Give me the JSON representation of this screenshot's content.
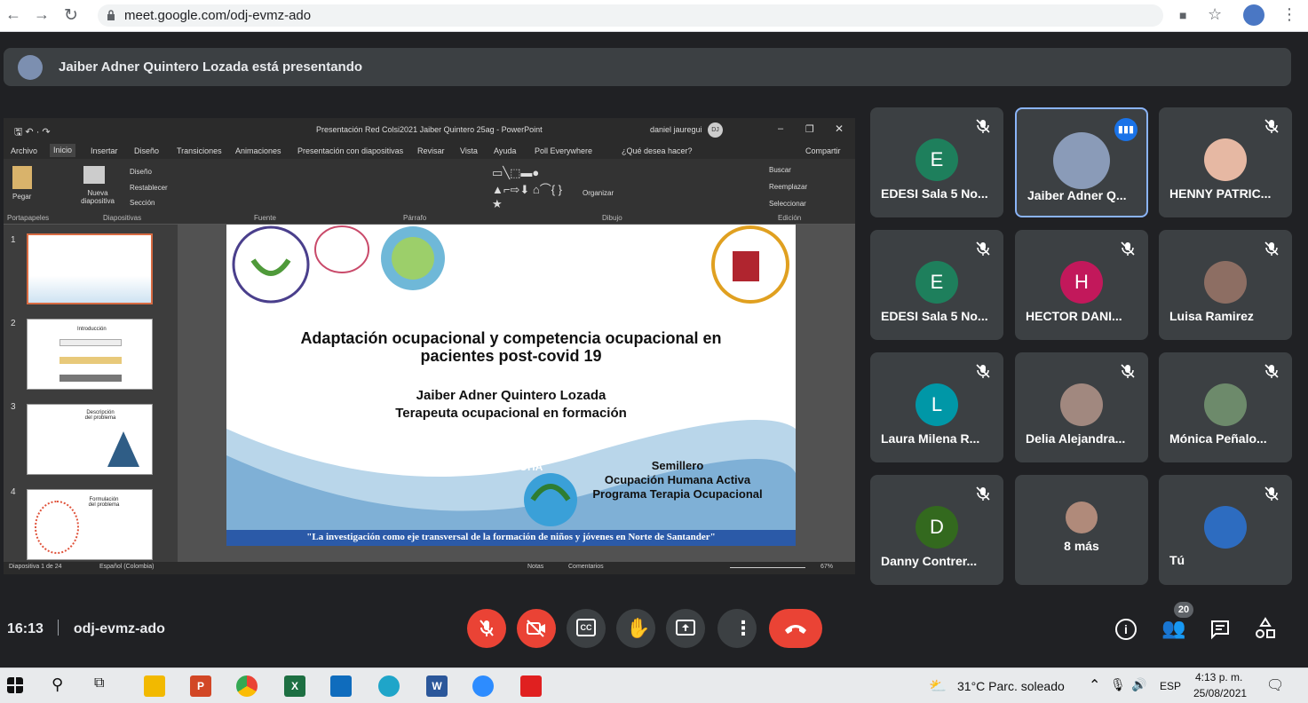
{
  "browser": {
    "url": "meet.google.com/odj-evmz-ado"
  },
  "presenting": {
    "text": "Jaiber Adner Quintero Lozada está presentando"
  },
  "powerpoint": {
    "window_title": "Presentación Red Colsi2021 Jaiber Quintero 25ag  -  PowerPoint",
    "user": "daniel jauregui",
    "user_initials": "DJ",
    "tabs": [
      "Archivo",
      "Inicio",
      "Insertar",
      "Diseño",
      "Transiciones",
      "Animaciones",
      "Presentación con diapositivas",
      "Revisar",
      "Vista",
      "Ayuda",
      "Poll Everywhere",
      "¿Qué desea hacer?",
      "Compartir"
    ],
    "ribbon_groups": [
      "Portapapeles",
      "Diapositivas",
      "Fuente",
      "Párrafo",
      "Dibujo",
      "Edición"
    ],
    "ribbon_cmds": {
      "paste": "Pegar",
      "new_slide": "Nueva diapositiva",
      "layout": "Diseño",
      "reset": "Restablecer",
      "section": "Sección",
      "arrange": "Organizar",
      "find": "Buscar",
      "replace": "Reemplazar",
      "select": "Seleccionar"
    },
    "thumb_labels": [
      "1",
      "2",
      "3",
      "4"
    ],
    "thumb_titles": [
      "",
      "Introducción",
      "Descripción del problema",
      "Formulación del problema"
    ],
    "status": {
      "slide": "Diapositiva 1 de 24",
      "lang": "Español (Colombia)",
      "notes": "Notas",
      "comments": "Comentarios",
      "zoom": "67%"
    },
    "slide": {
      "title_line1": "Adaptación ocupacional y competencia ocupacional en",
      "title_line2": "pacientes post-covid 19",
      "author": "Jaiber Adner Quintero Lozada",
      "role": "Terapeuta ocupacional en formación",
      "group_line1": "Semillero",
      "group_line2": "Ocupación Humana Activa",
      "group_line3": "Programa Terapia Ocupacional",
      "logo_text": "Semillero OHA",
      "footer": "\"La investigación como eje transversal de la formación de niños y jóvenes en Norte de Santander\""
    }
  },
  "participants": [
    {
      "name": "EDESI Sala 5 No...",
      "initial": "E",
      "color": "#1e7f5c",
      "muted": true,
      "photo": false
    },
    {
      "name": "Jaiber Adner Q...",
      "initial": "",
      "color": "#8a9bb8",
      "muted": false,
      "photo": true,
      "speaking": true
    },
    {
      "name": "HENNY PATRIC...",
      "initial": "",
      "color": "#e6b8a3",
      "muted": true,
      "photo": true
    },
    {
      "name": "EDESI Sala 5 No...",
      "initial": "E",
      "color": "#1e7f5c",
      "muted": true,
      "photo": false
    },
    {
      "name": "HECTOR DANI...",
      "initial": "H",
      "color": "#c2185b",
      "muted": true,
      "photo": false
    },
    {
      "name": "Luisa Ramirez",
      "initial": "",
      "color": "#8d6e63",
      "muted": true,
      "photo": true
    },
    {
      "name": "Laura Milena R...",
      "initial": "L",
      "color": "#0097a7",
      "muted": true,
      "photo": false
    },
    {
      "name": "Delia Alejandra...",
      "initial": "",
      "color": "#a1887f",
      "muted": true,
      "photo": true
    },
    {
      "name": "Mónica Peñalo...",
      "initial": "",
      "color": "#6d8a6b",
      "muted": true,
      "photo": true
    },
    {
      "name": "Danny Contrer...",
      "initial": "D",
      "color": "#33691e",
      "muted": true,
      "photo": false
    },
    {
      "name": "8 más",
      "initial": "",
      "color": "#b08a7a",
      "muted": false,
      "photo": true
    },
    {
      "name": "Tú",
      "initial": "",
      "color": "#2d6cc0",
      "muted": true,
      "photo": true
    }
  ],
  "bottom": {
    "time": "16:13",
    "code": "odj-evmz-ado",
    "people_count": "20"
  },
  "taskbar": {
    "weather": "31°C  Parc. soleado",
    "lang": "ESP",
    "time": "4:13 p. m.",
    "date": "25/08/2021"
  }
}
